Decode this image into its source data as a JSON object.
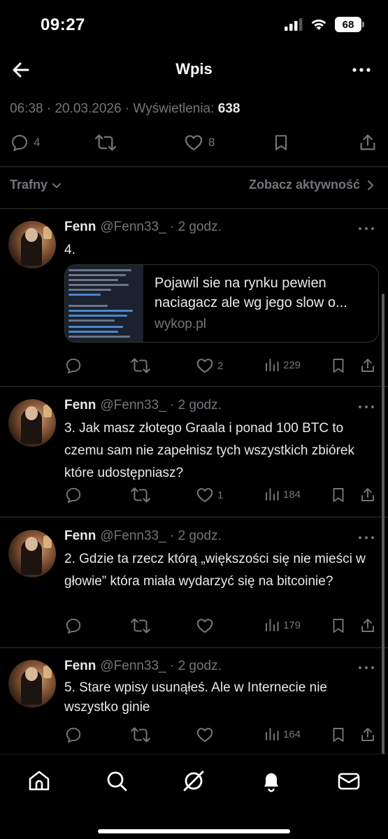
{
  "status_bar": {
    "time": "09:27",
    "battery": "68"
  },
  "nav": {
    "title": "Wpis"
  },
  "post_meta": {
    "time": "06:38",
    "date": "20.03.2026",
    "views_label": "Wyświetlenia:",
    "views_count": "638"
  },
  "post_actions": {
    "replies": "4",
    "likes": "8"
  },
  "sort": {
    "label": "Trafny",
    "activity_label": "Zobacz aktywność"
  },
  "replies": [
    {
      "name": "Fenn",
      "handle": "@Fenn33_ · 2 godz.",
      "text": "4.",
      "link_card": {
        "title": "Pojawil sie na rynku pewien naciagacz ale wg jego slow o...",
        "domain": "wykop.pl"
      },
      "likes": "2",
      "views": "229"
    },
    {
      "name": "Fenn",
      "handle": "@Fenn33_ · 2 godz.",
      "text": "3. Jak masz złotego Graala i ponad 100 BTC to czemu sam nie zapełnisz tych wszystkich zbiórek które udostępniasz?",
      "likes": "1",
      "views": "184"
    },
    {
      "name": "Fenn",
      "handle": "@Fenn33_ · 2 godz.",
      "text": "2. Gdzie ta rzecz którą „większości się nie mieści w głowie” która miała wydarzyć się na bitcoinie?",
      "likes": "",
      "views": "179"
    },
    {
      "name": "Fenn",
      "handle": "@Fenn33_ · 2 godz.",
      "text": "5. Stare wpisy usunąłeś. Ale w Internecie nie wszystko ginie",
      "likes": "",
      "views": "164"
    }
  ],
  "colors": {
    "background": "#000000",
    "text": "#e7e9ea",
    "muted": "#71767b",
    "divider": "#2f3336"
  },
  "icons": [
    "back-arrow-icon",
    "more-icon",
    "reply-icon",
    "retweet-icon",
    "heart-icon",
    "bookmark-icon",
    "share-icon",
    "views-icon",
    "chevron-down-icon",
    "chevron-right-icon",
    "home-icon",
    "search-icon",
    "grok-icon",
    "bell-icon",
    "mail-icon"
  ]
}
